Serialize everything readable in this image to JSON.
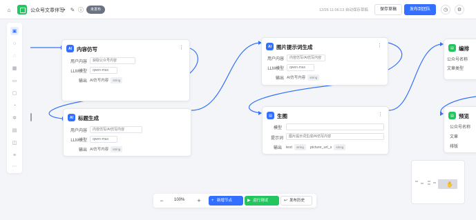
{
  "header": {
    "title": "公众号文章伴写",
    "status": "未发布",
    "save_time": "12/26 11:06:13 自动保存草稿",
    "save_draft": "保存草稿",
    "publish": "发布到团队"
  },
  "canvas": {
    "nodes": {
      "content_write": {
        "title": "内容仿写",
        "icon": "AI",
        "rows": [
          {
            "label": "用户内容",
            "value": "获取公众号内容"
          },
          {
            "label": "LLM模型",
            "value": "qwen-max"
          },
          {
            "label": "输出",
            "value": "AI仿写内容",
            "tag": "string"
          }
        ]
      },
      "title_gen": {
        "title": "标题生成",
        "icon": "AI",
        "rows": [
          {
            "label": "用户内容",
            "value": "内容仿写/AI仿写内容"
          },
          {
            "label": "LLM模型",
            "value": "qwen-max"
          },
          {
            "label": "输出",
            "value": "AI仿写内容",
            "tag": "string"
          }
        ]
      },
      "image_prompt": {
        "title": "图片提示词生成",
        "icon": "AI",
        "rows": [
          {
            "label": "用户内容",
            "value": "内容仿写/AI仿写内容"
          },
          {
            "label": "LLM模型",
            "value": "qwen-max"
          },
          {
            "label": "输出",
            "value": "AI仿写内容",
            "tag": "string"
          }
        ]
      },
      "image_gen": {
        "title": "生图",
        "rows": [
          {
            "label": "模型",
            "value": ""
          },
          {
            "label": "提示词",
            "value": "图片提示词生成/AI仿写内容"
          },
          {
            "label": "输出",
            "value": "text",
            "tag": "string",
            "value2": "picture_url_s",
            "tag2": "string"
          }
        ]
      },
      "right_top": {
        "title": "编排",
        "rows": [
          {
            "label": "公众号名称",
            "value": ""
          },
          {
            "label": "文章类型",
            "value": ""
          }
        ]
      },
      "right_bottom": {
        "title": "预览",
        "rows": [
          {
            "label": "公众号名称",
            "value": ""
          },
          {
            "label": "文章",
            "value": ""
          },
          {
            "label": "排版",
            "value": ""
          }
        ]
      }
    }
  },
  "toolbar": {
    "zoom": "100%",
    "minus": "−",
    "plus": "+",
    "add_node": "新增节点",
    "run_test": "运行测试",
    "publish_list": "发布历史"
  },
  "colors": {
    "primary": "#3370ff",
    "green": "#22c55e",
    "edge": "#3370ff"
  }
}
